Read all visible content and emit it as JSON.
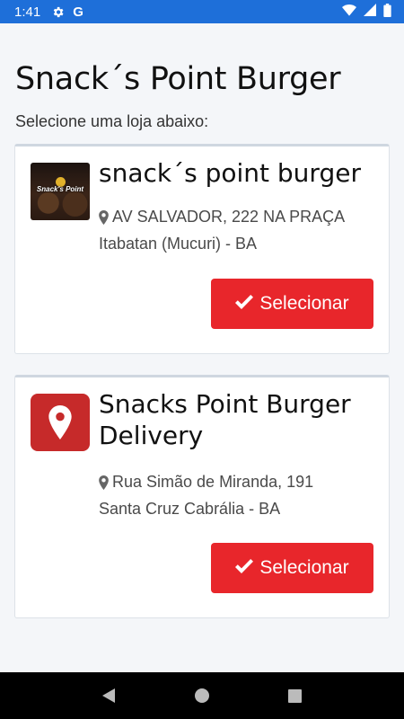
{
  "status_bar": {
    "time": "1:41",
    "icons": [
      "gear-icon",
      "google-g-icon",
      "wifi-icon",
      "signal-icon",
      "battery-icon"
    ],
    "google_letter": "G"
  },
  "page": {
    "title": "Snack´s Point Burger",
    "subtitle": "Selecione uma loja abaixo:"
  },
  "stores": [
    {
      "name": "snack´s point burger",
      "address": "AV SALVADOR, 222 NA PRAÇA",
      "city": "Itabatan (Mucuri) - BA",
      "logo_type": "photo",
      "logo_text": "Snack's Point",
      "button_label": "Selecionar"
    },
    {
      "name": "Snacks Point Burger Delivery",
      "address": "Rua Simão de Miranda, 191",
      "city": "Santa Cruz Cabrália - BA",
      "logo_type": "map-pin-icon",
      "button_label": "Selecionar"
    }
  ],
  "colors": {
    "status_bar": "#1e6fd9",
    "accent_button": "#e8262b",
    "pin_logo": "#c62a2a",
    "background": "#f4f6f9"
  },
  "nav_bar": {
    "buttons": [
      "back-icon",
      "home-icon",
      "recents-icon"
    ]
  }
}
